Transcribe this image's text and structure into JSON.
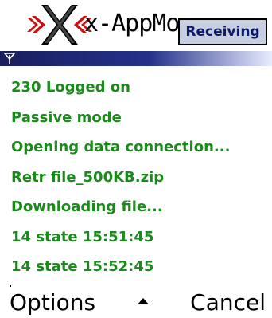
{
  "header": {
    "app_title": "x-AppMo",
    "status": "Receiving",
    "logo_icon": "x-cross-logo-icon"
  },
  "status_bar": {
    "signal_icon": "antenna-signal-icon"
  },
  "log": [
    "230 Logged on",
    "Passive mode",
    "Opening data connection...",
    "Retr file_500KB.zip",
    "Downloading file...",
    "14 state 15:51:45",
    "14 state 15:52:45"
  ],
  "softkeys": {
    "left": "Options",
    "middle_icon": "up-arrow-icon",
    "right": "Cancel"
  },
  "colors": {
    "log_text": "#1a8a1a",
    "status_bg": "#c8cfe0",
    "status_text": "#0d1a66",
    "bar_dark": "#1a1f5e",
    "logo_red": "#d01010"
  }
}
